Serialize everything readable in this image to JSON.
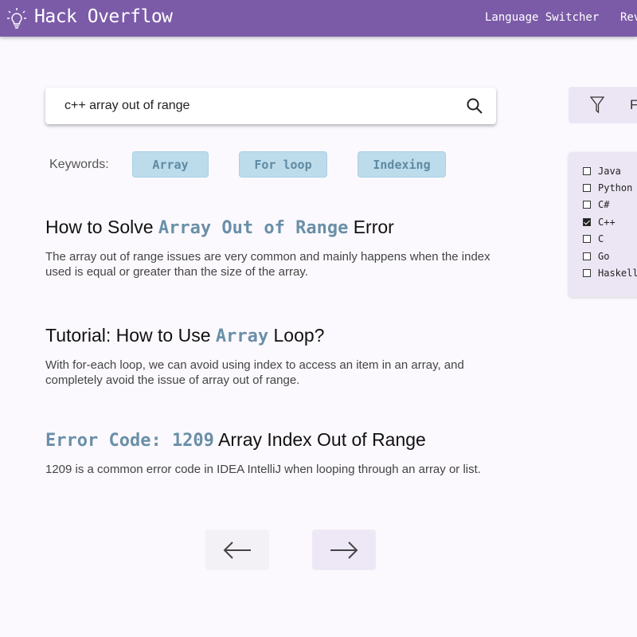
{
  "header": {
    "title": "Hack Overflow",
    "nav": [
      "Language Switcher",
      "Rev"
    ],
    "color": "#7b5ba8",
    "logo_icon": "lightbulb-icon"
  },
  "search": {
    "value": "c++ array out of range",
    "icon": "search-icon"
  },
  "keywords": {
    "label": "Keywords:",
    "chips": [
      "Array",
      "For loop",
      "Indexing"
    ]
  },
  "results": [
    {
      "pre": "How to Solve ",
      "hl": "Array Out of Range",
      "post": " Error",
      "desc": "The array out of range issues are very common and mainly happens when the index used is equal or greater than the size of the array."
    },
    {
      "pre": "Tutorial: How to Use ",
      "hl": "Array",
      "post": " Loop?",
      "desc": "With for-each loop, we can avoid using index to access an item in an array, and completely avoid the issue of array out of range."
    },
    {
      "pre": "",
      "hl": "Error Code: 1209",
      "post": " Array Index Out of Range",
      "desc": "1209 is a common error code in IDEA IntelliJ when looping through an array or list."
    }
  ],
  "pagination": {
    "prev_icon": "arrow-left-icon",
    "next_icon": "arrow-right-icon"
  },
  "filter": {
    "label": "F",
    "icon": "filter-icon",
    "options": [
      {
        "label": "Java",
        "checked": false
      },
      {
        "label": "Python",
        "checked": false
      },
      {
        "label": "C#",
        "checked": false
      },
      {
        "label": "C++",
        "checked": true
      },
      {
        "label": "C",
        "checked": false
      },
      {
        "label": "Go",
        "checked": false
      },
      {
        "label": "Haskell",
        "checked": false
      }
    ]
  },
  "colors": {
    "highlight": "#6a8fa8",
    "chip_bg": "#bcdcec",
    "panel_bg": "#ece6f4"
  }
}
